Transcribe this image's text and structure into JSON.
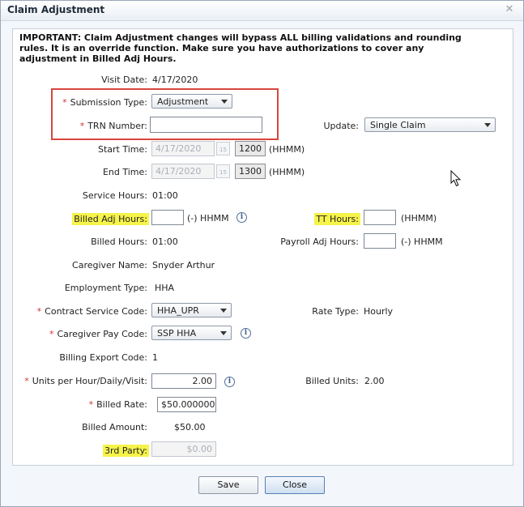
{
  "dialog": {
    "title": "Claim Adjustment"
  },
  "notice": "IMPORTANT: Claim Adjustment changes will bypass ALL billing validations and rounding rules. It is an override function. Make sure you have authorizations to cover any adjustment in Billed Adj Hours.",
  "fields": {
    "visit_date": {
      "label": "Visit Date:",
      "value": "4/17/2020"
    },
    "submission_type": {
      "label": "Submission Type:",
      "value": "Adjustment"
    },
    "trn_number": {
      "label": "TRN Number:",
      "value": ""
    },
    "update": {
      "label": "Update:",
      "value": "Single Claim"
    },
    "start_time": {
      "label": "Start Time:",
      "date": "4/17/2020",
      "time": "1200",
      "unit": "(HHMM)"
    },
    "end_time": {
      "label": "End Time:",
      "date": "4/17/2020",
      "time": "1300",
      "unit": "(HHMM)"
    },
    "service_hours": {
      "label": "Service Hours:",
      "value": "01:00"
    },
    "billed_adj_hours": {
      "label": "Billed Adj Hours:",
      "value": "",
      "unit": "(-) HHMM"
    },
    "tt_hours": {
      "label": "TT Hours:",
      "value": "",
      "unit": "(HHMM)"
    },
    "billed_hours": {
      "label": "Billed Hours:",
      "value": "01:00"
    },
    "payroll_adj_hours": {
      "label": "Payroll Adj Hours:",
      "value": "",
      "unit": "(-) HHMM"
    },
    "caregiver_name": {
      "label": "Caregiver Name:",
      "value": "Snyder Arthur"
    },
    "employment_type": {
      "label": "Employment Type:",
      "value": "HHA"
    },
    "contract_service_code": {
      "label": "Contract Service Code:",
      "value": "HHA_UPR"
    },
    "rate_type": {
      "label": "Rate Type:",
      "value": "Hourly"
    },
    "caregiver_pay_code": {
      "label": "Caregiver Pay Code:",
      "value": "SSP HHA"
    },
    "billing_export_code": {
      "label": "Billing Export Code:",
      "value": "1"
    },
    "units": {
      "label": "Units per Hour/Daily/Visit:",
      "value": "2.00"
    },
    "billed_units": {
      "label": "Billed Units:",
      "value": "2.00"
    },
    "billed_rate": {
      "label": "Billed Rate:",
      "value": "$50.000000"
    },
    "billed_amount": {
      "label": "Billed Amount:",
      "value": "$50.00"
    },
    "third_party": {
      "label": "3rd Party:",
      "value": "$0.00"
    }
  },
  "buttons": {
    "save": "Save",
    "close": "Close"
  },
  "icons": {
    "calendar": "calendar-icon",
    "info": "info-icon",
    "close": "close-icon",
    "caret": "chevron-down-icon"
  },
  "colors": {
    "required": "#d2352e",
    "highlight": "#f6f34a",
    "annotation_box": "#d9463e"
  }
}
